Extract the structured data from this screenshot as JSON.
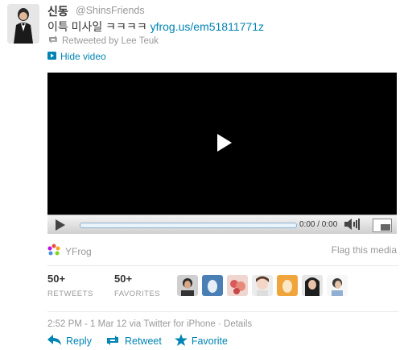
{
  "tweet": {
    "name": "신동",
    "handle": "@ShinsFriends",
    "text": "이특 미사일 ㅋㅋㅋㅋ",
    "link": "yfrog.us/em51811771z",
    "retweeted_by": "Retweeted by Lee Teuk",
    "hide_video": "Hide video"
  },
  "player": {
    "time": "0:00 / 0:00"
  },
  "media": {
    "source": "YFrog",
    "flag": "Flag this media"
  },
  "stats": {
    "retweets_count": "50+",
    "retweets_label": "RETWEETS",
    "favorites_count": "50+",
    "favorites_label": "FAVORITES"
  },
  "meta": "2:52 PM - 1 Mar 12 via Twitter for iPhone · Details",
  "actions": {
    "reply": "Reply",
    "retweet": "Retweet",
    "favorite": "Favorite"
  },
  "colors": {
    "link": "#0084b4",
    "muted": "#999999"
  }
}
